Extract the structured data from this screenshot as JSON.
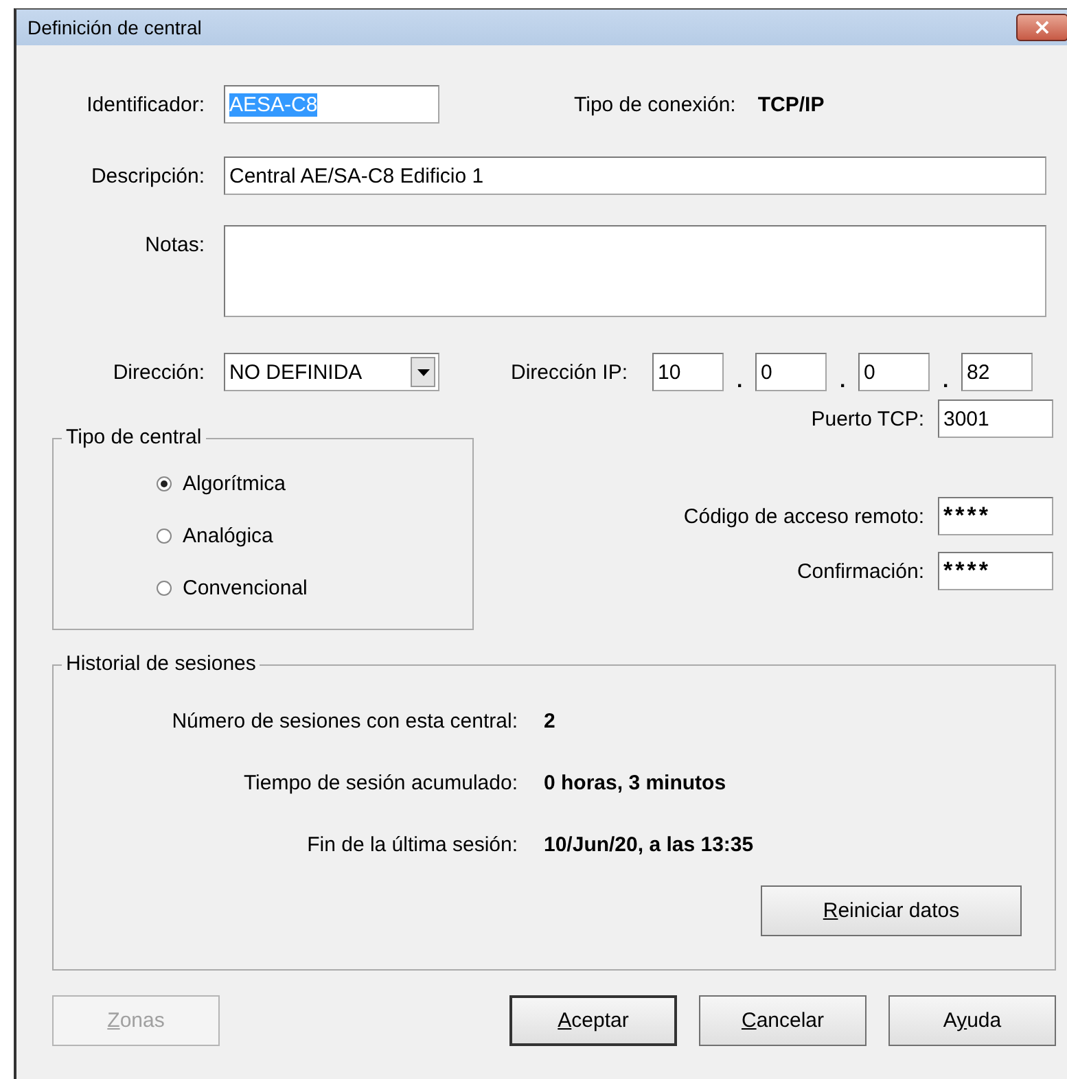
{
  "window": {
    "title": "Definición de central",
    "close": "×"
  },
  "identificador": {
    "label": "Identificador:",
    "value": "AESA-C8",
    "text_selected": true
  },
  "tipo_conexion": {
    "label": "Tipo de conexión:",
    "value": "TCP/IP"
  },
  "descripcion": {
    "label": "Descripción:",
    "value": "Central AE/SA-C8 Edificio 1"
  },
  "notas": {
    "label": "Notas:"
  },
  "direccion": {
    "label": "Dirección:",
    "value": "NO DEFINIDA"
  },
  "direccion_ip": {
    "label": "Dirección IP:",
    "octets": [
      "10",
      "0",
      "0",
      "82"
    ],
    "separator": "."
  },
  "puerto_tcp": {
    "label": "Puerto TCP:",
    "value": "3001"
  },
  "tipo_central": {
    "title": "Tipo de central",
    "options": [
      {
        "label": "Algorítmica",
        "selected": true
      },
      {
        "label": "Analógica",
        "selected": false
      },
      {
        "label": "Convencional",
        "selected": false
      }
    ]
  },
  "codigo_acceso": {
    "label": "Código de acceso remoto:",
    "value": "****"
  },
  "confirmacion": {
    "label": "Confirmación:",
    "value": "****"
  },
  "historial": {
    "title": "Historial de sesiones",
    "rows": [
      {
        "label": "Número de sesiones con esta central:",
        "value": "2"
      },
      {
        "label": "Tiempo de sesión acumulado:",
        "value": "0 horas, 3 minutos"
      },
      {
        "label": "Fin de la última sesión:",
        "value": "10/Jun/20, a las 13:35"
      }
    ],
    "button": {
      "key": "R",
      "post": "einiciar datos",
      "disabled": false,
      "default": false
    }
  },
  "buttons": [
    {
      "key": "Z",
      "post": "onas",
      "disabled": true,
      "default": false
    },
    {
      "key": "A",
      "post": "ceptar",
      "disabled": false,
      "default": true
    },
    {
      "key": "C",
      "post": "ancelar",
      "disabled": false,
      "default": false
    },
    {
      "pre": "A",
      "key": "y",
      "post": "uda",
      "disabled": false,
      "default": false
    }
  ]
}
